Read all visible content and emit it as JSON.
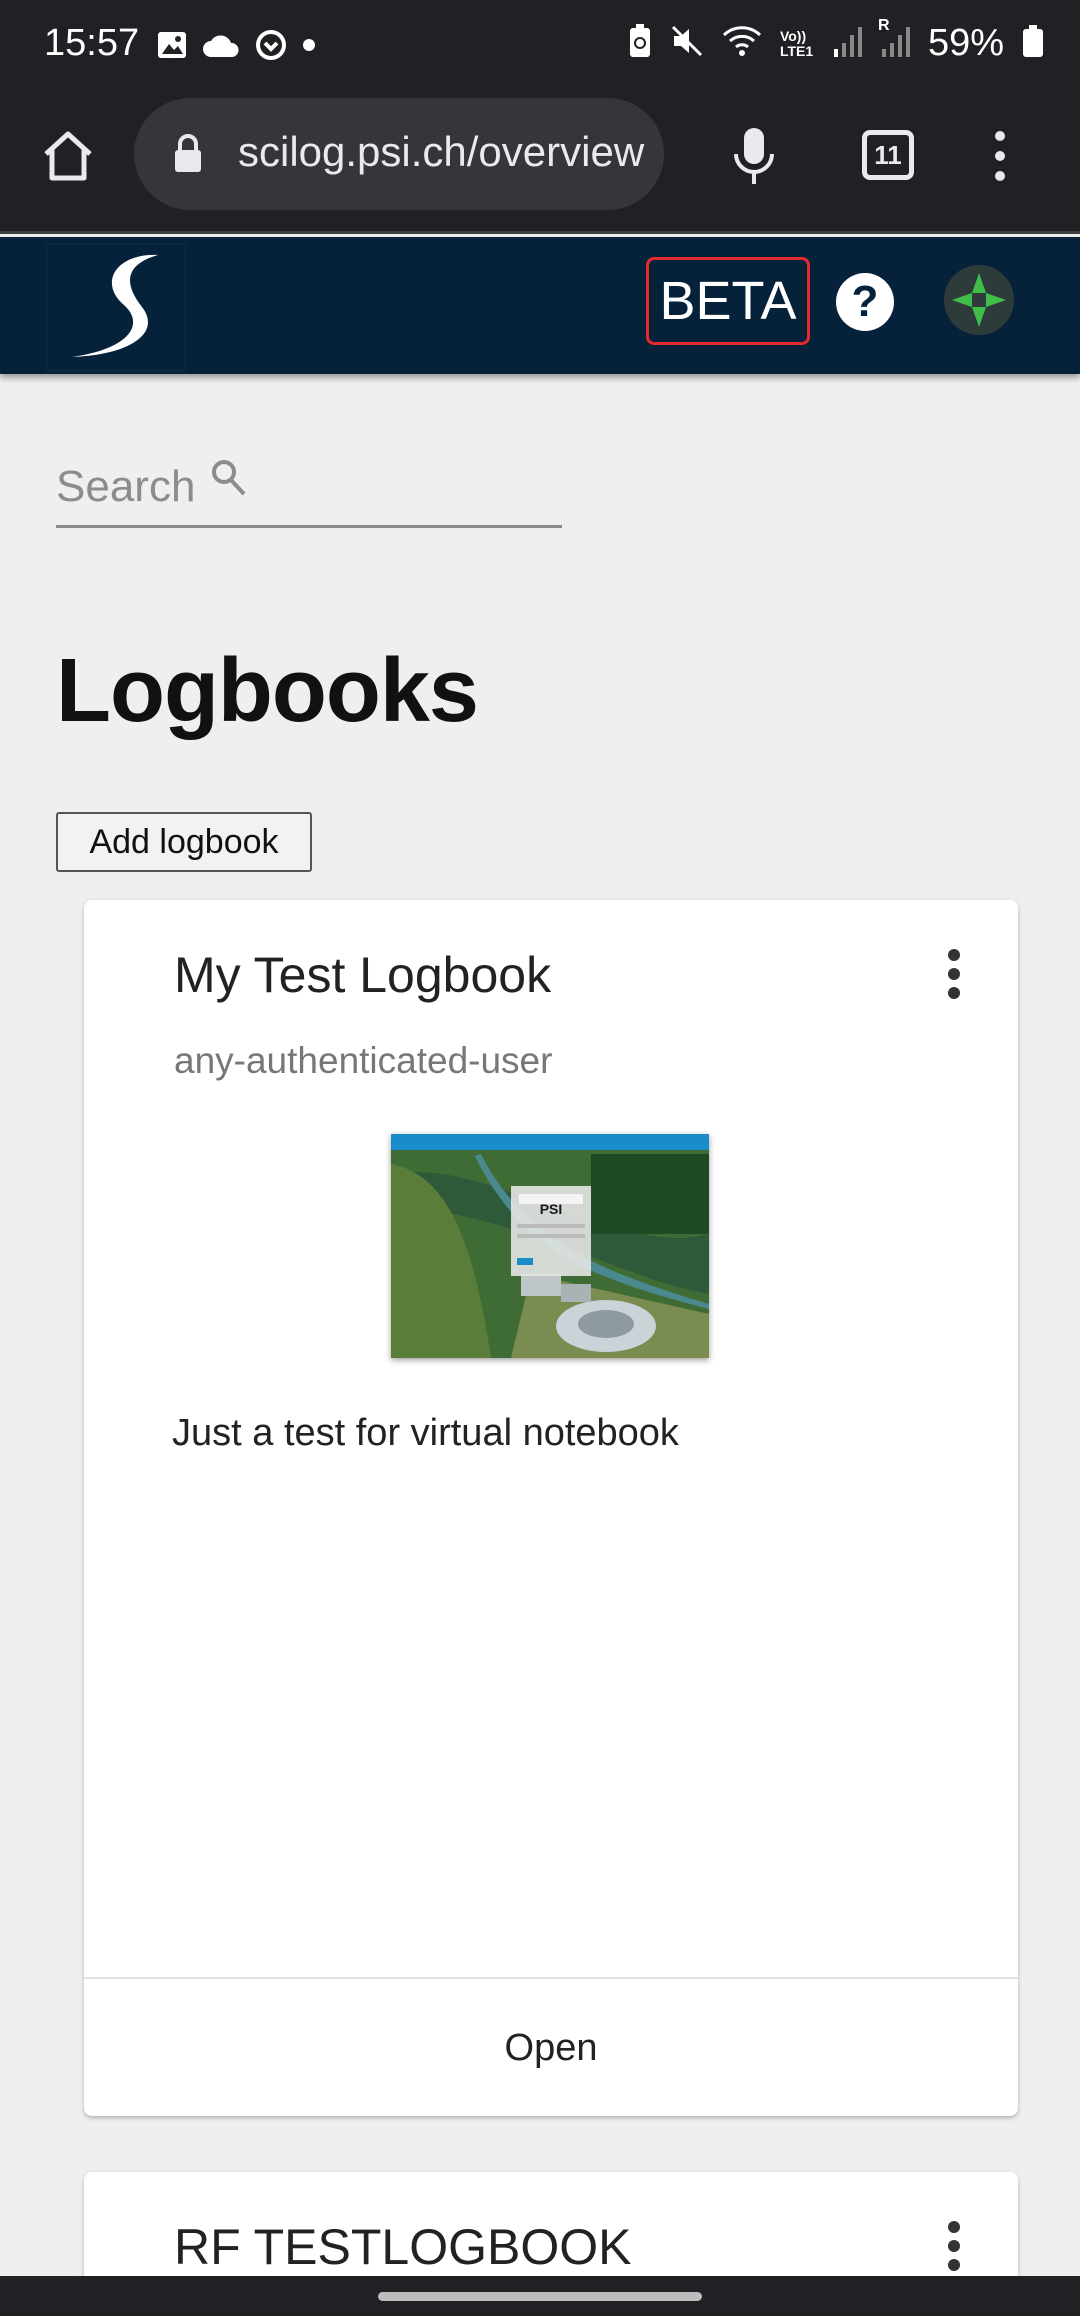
{
  "status_bar": {
    "time": "15:57",
    "battery_percent": "59%",
    "icons_left": [
      "gallery-icon",
      "cloud-icon",
      "sync-icon",
      "dot-icon"
    ],
    "icons_right": [
      "battery-saver-icon",
      "mute-icon",
      "wifi-icon",
      "volte-icon",
      "signal-icon",
      "signal-roaming-icon",
      "battery-icon"
    ],
    "volte_label": "Vo)) LTE1",
    "roaming_label": "R"
  },
  "browser": {
    "url": "scilog.psi.ch/overview",
    "tab_count": "11"
  },
  "header": {
    "beta_label": "BETA",
    "help_label": "?"
  },
  "search": {
    "placeholder": "Search"
  },
  "page": {
    "title": "Logbooks",
    "add_button": "Add logbook"
  },
  "logbooks": [
    {
      "title": "My Test Logbook",
      "owner_group": "any-authenticated-user",
      "description": "Just a test for virtual notebook",
      "open_label": "Open",
      "thumbnail_text": "PSI"
    },
    {
      "title": "RF TESTLOGBOOK"
    }
  ],
  "colors": {
    "status_bar_bg": "#202124",
    "app_header_bg": "#06213a",
    "beta_border": "#e52b2b",
    "page_bg": "#efefef"
  }
}
